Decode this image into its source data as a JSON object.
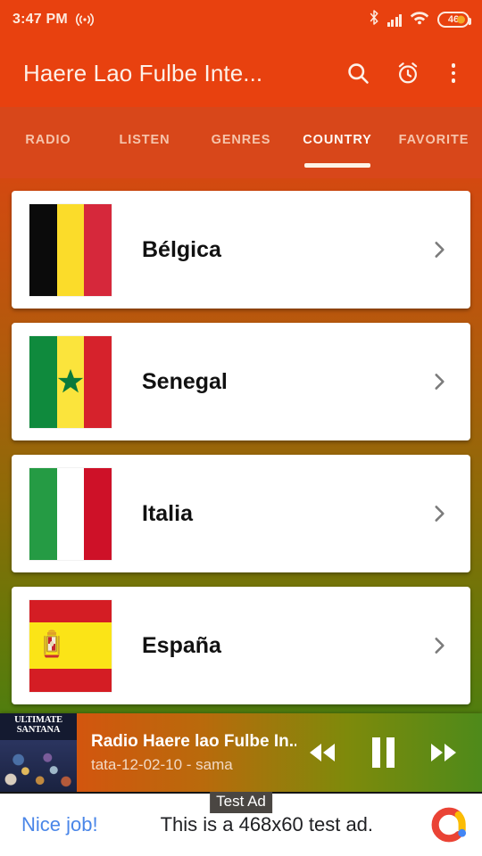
{
  "status_bar": {
    "time": "3:47 PM",
    "cast_icon": "broadcast-icon",
    "bluetooth_icon": "bluetooth-icon",
    "signal_icon": "cellular-signal-icon",
    "wifi_icon": "wifi-icon",
    "battery_level": "46"
  },
  "app_bar": {
    "title": "Haere Lao Fulbe Inte...",
    "search_icon": "search-icon",
    "alarm_icon": "alarm-clock-icon",
    "overflow_icon": "more-vertical-icon",
    "background_color": "#e8410f"
  },
  "tabs": {
    "items": [
      {
        "label": "RADIO",
        "active": false
      },
      {
        "label": "LISTEN",
        "active": false
      },
      {
        "label": "GENRES",
        "active": false
      },
      {
        "label": "COUNTRY",
        "active": true
      },
      {
        "label": "FAVORITE",
        "active": false
      }
    ],
    "active_index": 3,
    "active_color": "#fff8f2",
    "inactive_color": "#f6c4ab"
  },
  "country_list": {
    "items": [
      {
        "name": "Bélgica",
        "flag": "belgium-flag-icon",
        "chevron": "chevron-right-icon"
      },
      {
        "name": "Senegal",
        "flag": "senegal-flag-icon",
        "chevron": "chevron-right-icon"
      },
      {
        "name": "Italia",
        "flag": "italy-flag-icon",
        "chevron": "chevron-right-icon"
      },
      {
        "name": "España",
        "flag": "spain-flag-icon",
        "chevron": "chevron-right-icon"
      }
    ]
  },
  "player": {
    "album_art_text": "ULTIMATE SANTANA",
    "title": "Radio Haere lao Fulbe In...",
    "subtitle": "tata-12-02-10 - sama",
    "rewind_icon": "rewind-icon",
    "pause_icon": "pause-icon",
    "forward_icon": "fast-forward-icon"
  },
  "ad": {
    "badge": "Test Ad",
    "cta": "Nice job!",
    "text": "This is a 468x60 test ad.",
    "logo_icon": "admob-logo-icon",
    "cta_color": "#4a86e8"
  }
}
